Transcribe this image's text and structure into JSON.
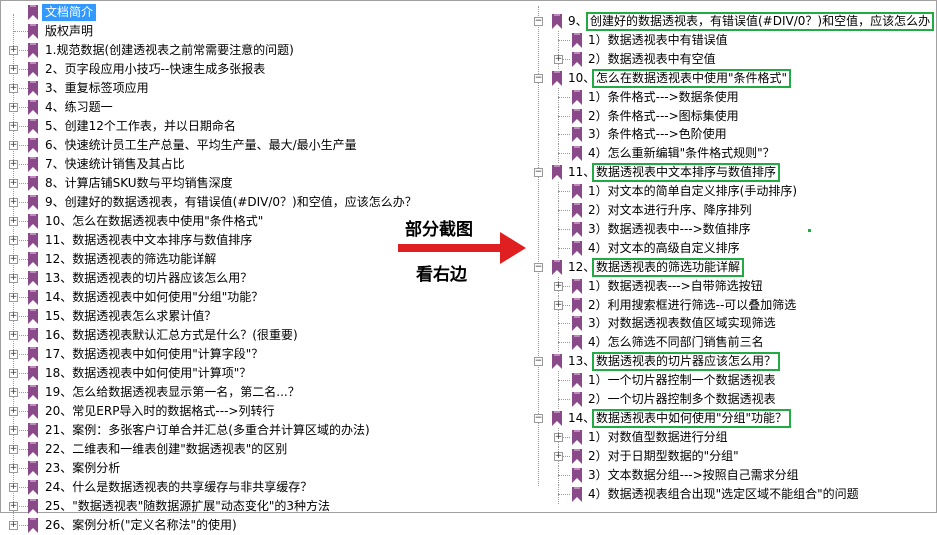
{
  "left_tree": {
    "root": "文档简介",
    "items": [
      {
        "label": "版权声明",
        "expandable": false
      },
      {
        "label": "1.规范数据(创建透视表之前常需要注意的问题)",
        "expandable": true
      },
      {
        "label": "2、页字段应用小技巧--快速生成多张报表",
        "expandable": true
      },
      {
        "label": "3、重复标签项应用",
        "expandable": true
      },
      {
        "label": "4、练习题一",
        "expandable": true
      },
      {
        "label": "5、创建12个工作表，并以日期命名",
        "expandable": true
      },
      {
        "label": "6、快速统计员工生产总量、平均生产量、最大/最小生产量",
        "expandable": true
      },
      {
        "label": "7、快速统计销售及其占比",
        "expandable": true
      },
      {
        "label": "8、计算店铺SKU数与平均销售深度",
        "expandable": true
      },
      {
        "label": "9、创建好的数据透视表，有错误值(#DIV/0？)和空值，应该怎么办？",
        "expandable": true
      },
      {
        "label": "10、怎么在数据透视表中使用\"条件格式\"",
        "expandable": true
      },
      {
        "label": "11、数据透视表中文本排序与数值排序",
        "expandable": true
      },
      {
        "label": "12、数据透视表的筛选功能详解",
        "expandable": true
      },
      {
        "label": "13、数据透视表的切片器应该怎么用？",
        "expandable": true
      },
      {
        "label": "14、数据透视表中如何使用\"分组\"功能？",
        "expandable": true
      },
      {
        "label": "15、数据透视表怎么求累计值？",
        "expandable": true
      },
      {
        "label": "16、数据透视表默认汇总方式是什么？(很重要)",
        "expandable": true
      },
      {
        "label": "17、数据透视表中如何使用\"计算字段\"？",
        "expandable": true
      },
      {
        "label": "18、数据透视表中如何使用\"计算项\"？",
        "expandable": true
      },
      {
        "label": "19、怎么给数据透视表显示第一名，第二名...？",
        "expandable": true
      },
      {
        "label": "20、常见ERP导入时的数据格式--->列转行",
        "expandable": true
      },
      {
        "label": "21、案例：多张客户订单合并汇总(多重合并计算区域的办法)",
        "expandable": true
      },
      {
        "label": "22、二维表和一维表创建\"数据透视表\"的区别",
        "expandable": true
      },
      {
        "label": "23、案例分析",
        "expandable": true
      },
      {
        "label": "24、什么是数据透视表的共享缓存与非共享缓存？",
        "expandable": true
      },
      {
        "label": "25、\"数据透视表\"随数据源扩展\"动态变化\"的3种方法",
        "expandable": true
      },
      {
        "label": "26、案例分析(\"定义名称法\"的使用)",
        "expandable": true
      }
    ]
  },
  "callout": {
    "line1": "部分截图",
    "line2": "看右边",
    "arrow_color": "#e02020"
  },
  "right_tree": {
    "rows": [
      {
        "level": 0,
        "num": "9、",
        "label": "创建好的数据透视表，有错误值(#DIV/0？)和空值，应该怎么办",
        "boxed": true
      },
      {
        "level": 1,
        "label": "1）数据透视表中有错误值"
      },
      {
        "level": 1,
        "label": "2）数据透视表中有空值",
        "expandable": true
      },
      {
        "level": 0,
        "num": "10、",
        "label": "怎么在数据透视表中使用\"条件格式\"",
        "boxed": true
      },
      {
        "level": 1,
        "label": "1）条件格式--->数据条使用"
      },
      {
        "level": 1,
        "label": "2）条件格式--->图标集使用"
      },
      {
        "level": 1,
        "label": "3）条件格式--->色阶使用"
      },
      {
        "level": 1,
        "label": "4）怎么重新编辑\"条件格式规则\"？"
      },
      {
        "level": 0,
        "num": "11、",
        "label": "数据透视表中文本排序与数值排序",
        "boxed": true
      },
      {
        "level": 1,
        "label": "1）对文本的简单自定义排序(手动排序)"
      },
      {
        "level": 1,
        "label": "2）对文本进行升序、降序排列"
      },
      {
        "level": 1,
        "label": "3）数据透视表中--->数值排序"
      },
      {
        "level": 1,
        "label": "4）对文本的高级自定义排序"
      },
      {
        "level": 0,
        "num": "12、",
        "label": "数据透视表的筛选功能详解",
        "boxed": true
      },
      {
        "level": 1,
        "label": "1）数据透视表--->自带筛选按钮",
        "expandable": true
      },
      {
        "level": 1,
        "label": "2）利用搜索框进行筛选--可以叠加筛选",
        "expandable": true
      },
      {
        "level": 1,
        "label": "3）对数据透视表数值区域实现筛选"
      },
      {
        "level": 1,
        "label": "4）怎么筛选不同部门销售前三名"
      },
      {
        "level": 0,
        "num": "13、",
        "label": "数据透视表的切片器应该怎么用？",
        "boxed": true
      },
      {
        "level": 1,
        "label": "1）一个切片器控制一个数据透视表"
      },
      {
        "level": 1,
        "label": "2）一个切片器控制多个数据透视表"
      },
      {
        "level": 0,
        "num": "14、",
        "label": "数据透视表中如何使用\"分组\"功能？",
        "boxed": true
      },
      {
        "level": 1,
        "label": "1）对数值型数据进行分组",
        "expandable": true
      },
      {
        "level": 1,
        "label": "2）对于日期型数据的\"分组\"",
        "expandable": true
      },
      {
        "level": 1,
        "label": "3）文本数据分组--->按照自己需求分组"
      },
      {
        "level": 1,
        "label": "4）数据透视表组合出现\"选定区域不能组合\"的问题"
      }
    ]
  },
  "colors": {
    "bookmark": "#8a4a8a",
    "selection": "#3399ff",
    "highlight_box": "#22aa44"
  }
}
